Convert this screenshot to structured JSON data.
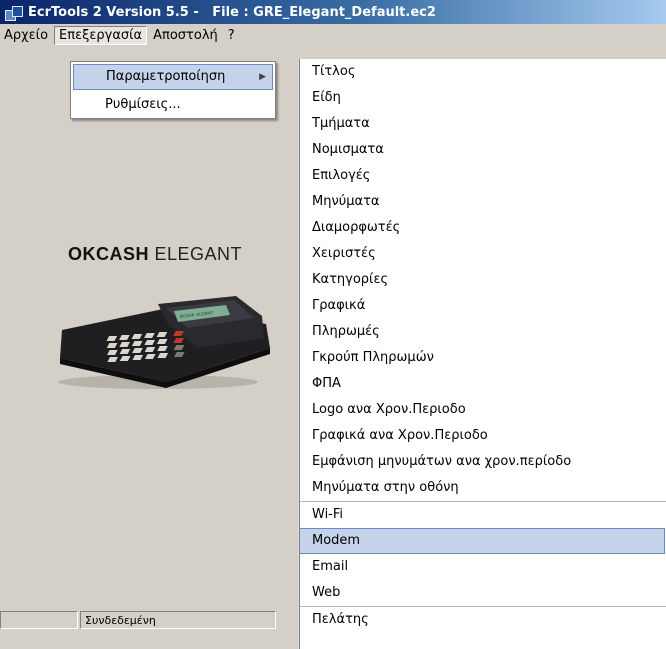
{
  "window": {
    "title": "EcrTools 2 Version 5.5 -   File : GRE_Elegant_Default.ec2",
    "icon": "app-icon"
  },
  "menubar": {
    "items": [
      "Αρχείο",
      "Επεξεργασία",
      "Αποστολή",
      "?"
    ],
    "active": "Επεξεργασία"
  },
  "edit_menu": {
    "items": [
      {
        "label": "Παραμετροποίηση",
        "submenu": true,
        "highlighted": true
      },
      {
        "label": "Ρυθμίσεις...",
        "submenu": false,
        "highlighted": false
      }
    ]
  },
  "submenu": {
    "items": [
      "Τίτλος",
      "Είδη",
      "Τμήματα",
      "Νομισματα",
      "Επιλογές",
      "Μηνύματα",
      "Διαμορφωτές",
      "Χειριστές",
      "Κατηγορίες",
      "Γραφικά",
      "Πληρωμές",
      "Γκρούπ Πληρωμών",
      "ΦΠΑ",
      "Logo ανα Χρον.Περιοδο",
      "Γραφικά ανα Χρον.Περιοδο",
      "Εμφάνιση μηνυμάτων ανα χρον.περίοδο",
      "Μηνύματα στην οθόνη",
      "Wi-Fi",
      "Modem",
      "Email",
      "Web",
      "Πελάτης"
    ],
    "highlighted": "Modem",
    "separators_before": [
      "Wi-Fi",
      "Πελάτης"
    ]
  },
  "brand": {
    "bold": "OKCASH",
    "regular": " ELEGANT"
  },
  "device_display_text": "OKCASH ELEGANT",
  "statusbar": {
    "cells": [
      "",
      "Συνδεδεμένη"
    ]
  },
  "colors": {
    "highlight_bg": "#c5d3ea",
    "highlight_border": "#6d89c4",
    "titlebar_start": "#0a246a",
    "titlebar_end": "#a6caf0"
  }
}
